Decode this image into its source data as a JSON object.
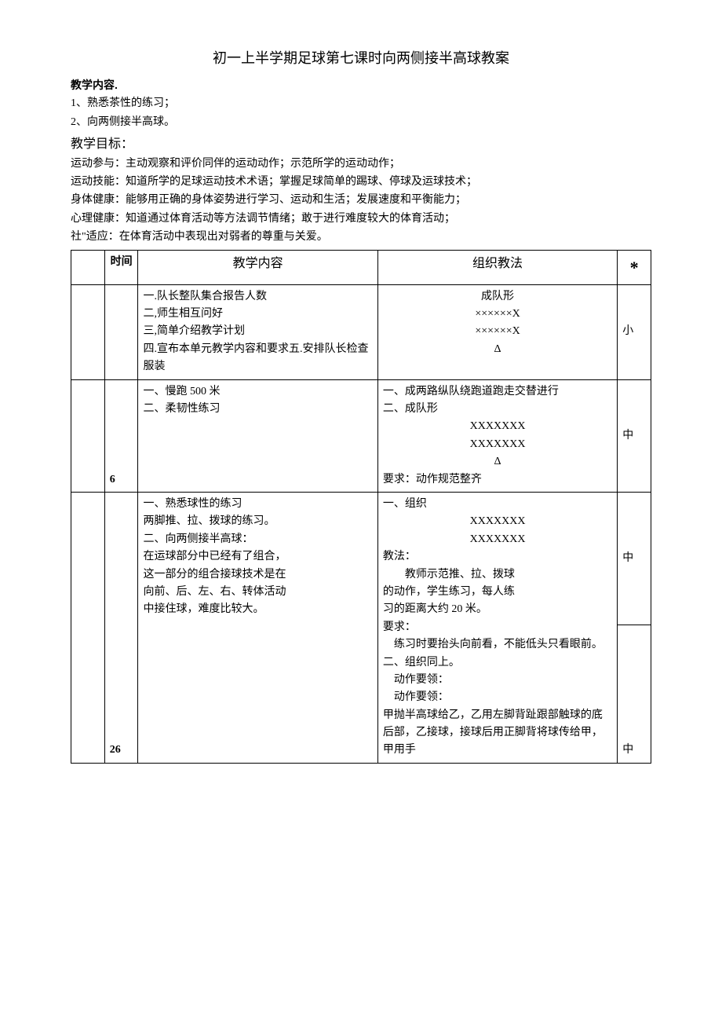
{
  "title": "初一上半学期足球第七课时向两侧接半高球教案",
  "content_heading": "教学内容.",
  "content_items": [
    "1、熟悉茶性的练习；",
    "2、向两侧接半高球。"
  ],
  "goals_heading": "教学目标：",
  "goals": [
    "运动参与：主动观察和评价同伴的运动动作；示范所学的运动动作；",
    "运动技能：知道所学的足球运动技术术语；掌握足球简单的踢球、停球及运球技术；",
    "身体健康：能够用正确的身体姿势进行学习、运动和生活；发展速度和平衡能力；",
    "心理健康：知道通过体育活动等方法调节情绪；敢于进行难度较大的体育活动；",
    "社\"适应：在体育活动中表现出对弱者的尊重与关爱。"
  ],
  "headers": {
    "time": "时间",
    "content": "教学内容",
    "method": "组织教法",
    "star": "*"
  },
  "rows": [
    {
      "time": "",
      "content": [
        "一.队长整队集合报告人数",
        "二,师生相互问好",
        "三,简单介绍教学计划",
        "四.宣布本单元教学内容和要求五.安排队长检查服装"
      ],
      "method_center": [
        "成队形",
        "××××××X",
        "××××××X",
        "Δ"
      ],
      "method_left": [],
      "star": "小"
    },
    {
      "time": "6",
      "content": [
        "一、慢跑 500 米",
        "二、柔韧性练习"
      ],
      "method_left_top": [
        "一、成两路纵队绕跑道跑走交替进行",
        "二、成队形"
      ],
      "method_center": [
        "XXXXXXX",
        "XXXXXXX",
        "Δ"
      ],
      "method_left_bottom": [
        "要求：动作规范整齐"
      ],
      "star": "中"
    },
    {
      "time": "26",
      "content": [
        "一、熟悉球性的练习",
        "两脚推、拉、拨球的练习。",
        "",
        "二、向两侧接半高球：",
        "在运球部分中已经有了组合，",
        "这一部分的组合接球技术是在",
        "向前、后、左、右、转体活动",
        "中接住球，难度比较大。"
      ],
      "method_left_1": [
        "一、组织"
      ],
      "method_center_1": [
        "XXXXXXX",
        "XXXXXXX"
      ],
      "method_left_2": [
        "教法：",
        "　　教师示范推、拉、拨球",
        "的动作，学生练习，每人练",
        "习的距离大约 20 米。",
        "要求：",
        "　练习时要抬头向前看，不能低头只看眼前。",
        "二、组织同上。",
        "　动作要领：",
        "　动作要领：",
        "甲抛半高球给乙，乙用左脚背趾跟部触球的底后部，乙接球，接球后用正脚背将球传给甲，甲用手"
      ],
      "star1": "中",
      "star2": "中"
    }
  ]
}
